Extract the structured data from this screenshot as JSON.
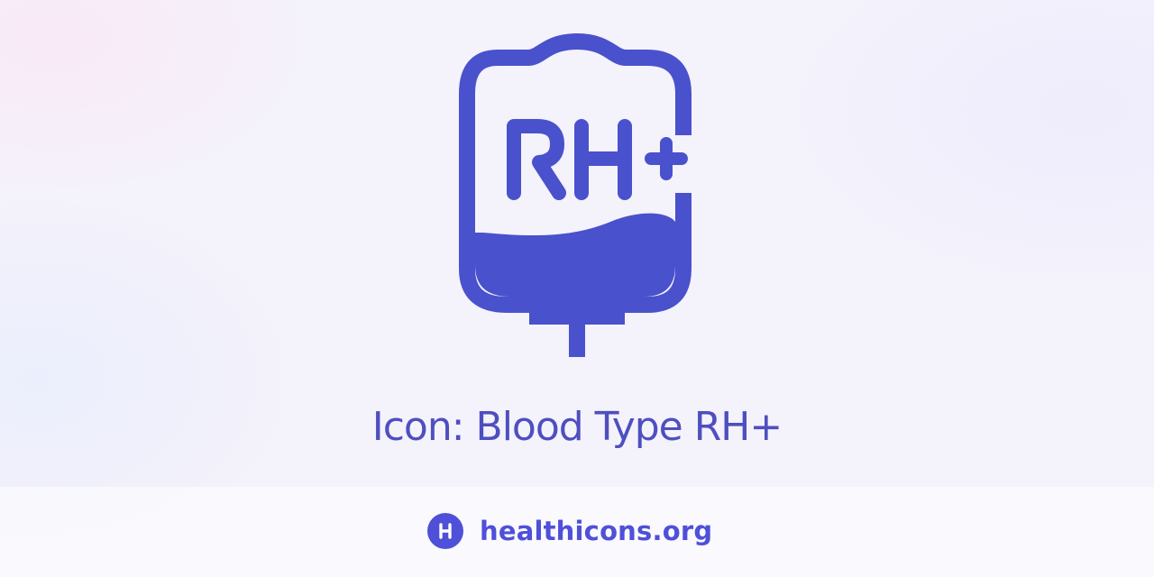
{
  "icon": {
    "name": "blood-bag-rh-positive-icon",
    "label": "RH+",
    "color": "#4a51cc"
  },
  "title": "Icon: Blood Type RH+",
  "footer": {
    "site_name": "healthicons.org",
    "logo_icon": "healthicons-logo-icon",
    "brand_color": "#4f50d9"
  },
  "background_color": "#f4f2fb"
}
